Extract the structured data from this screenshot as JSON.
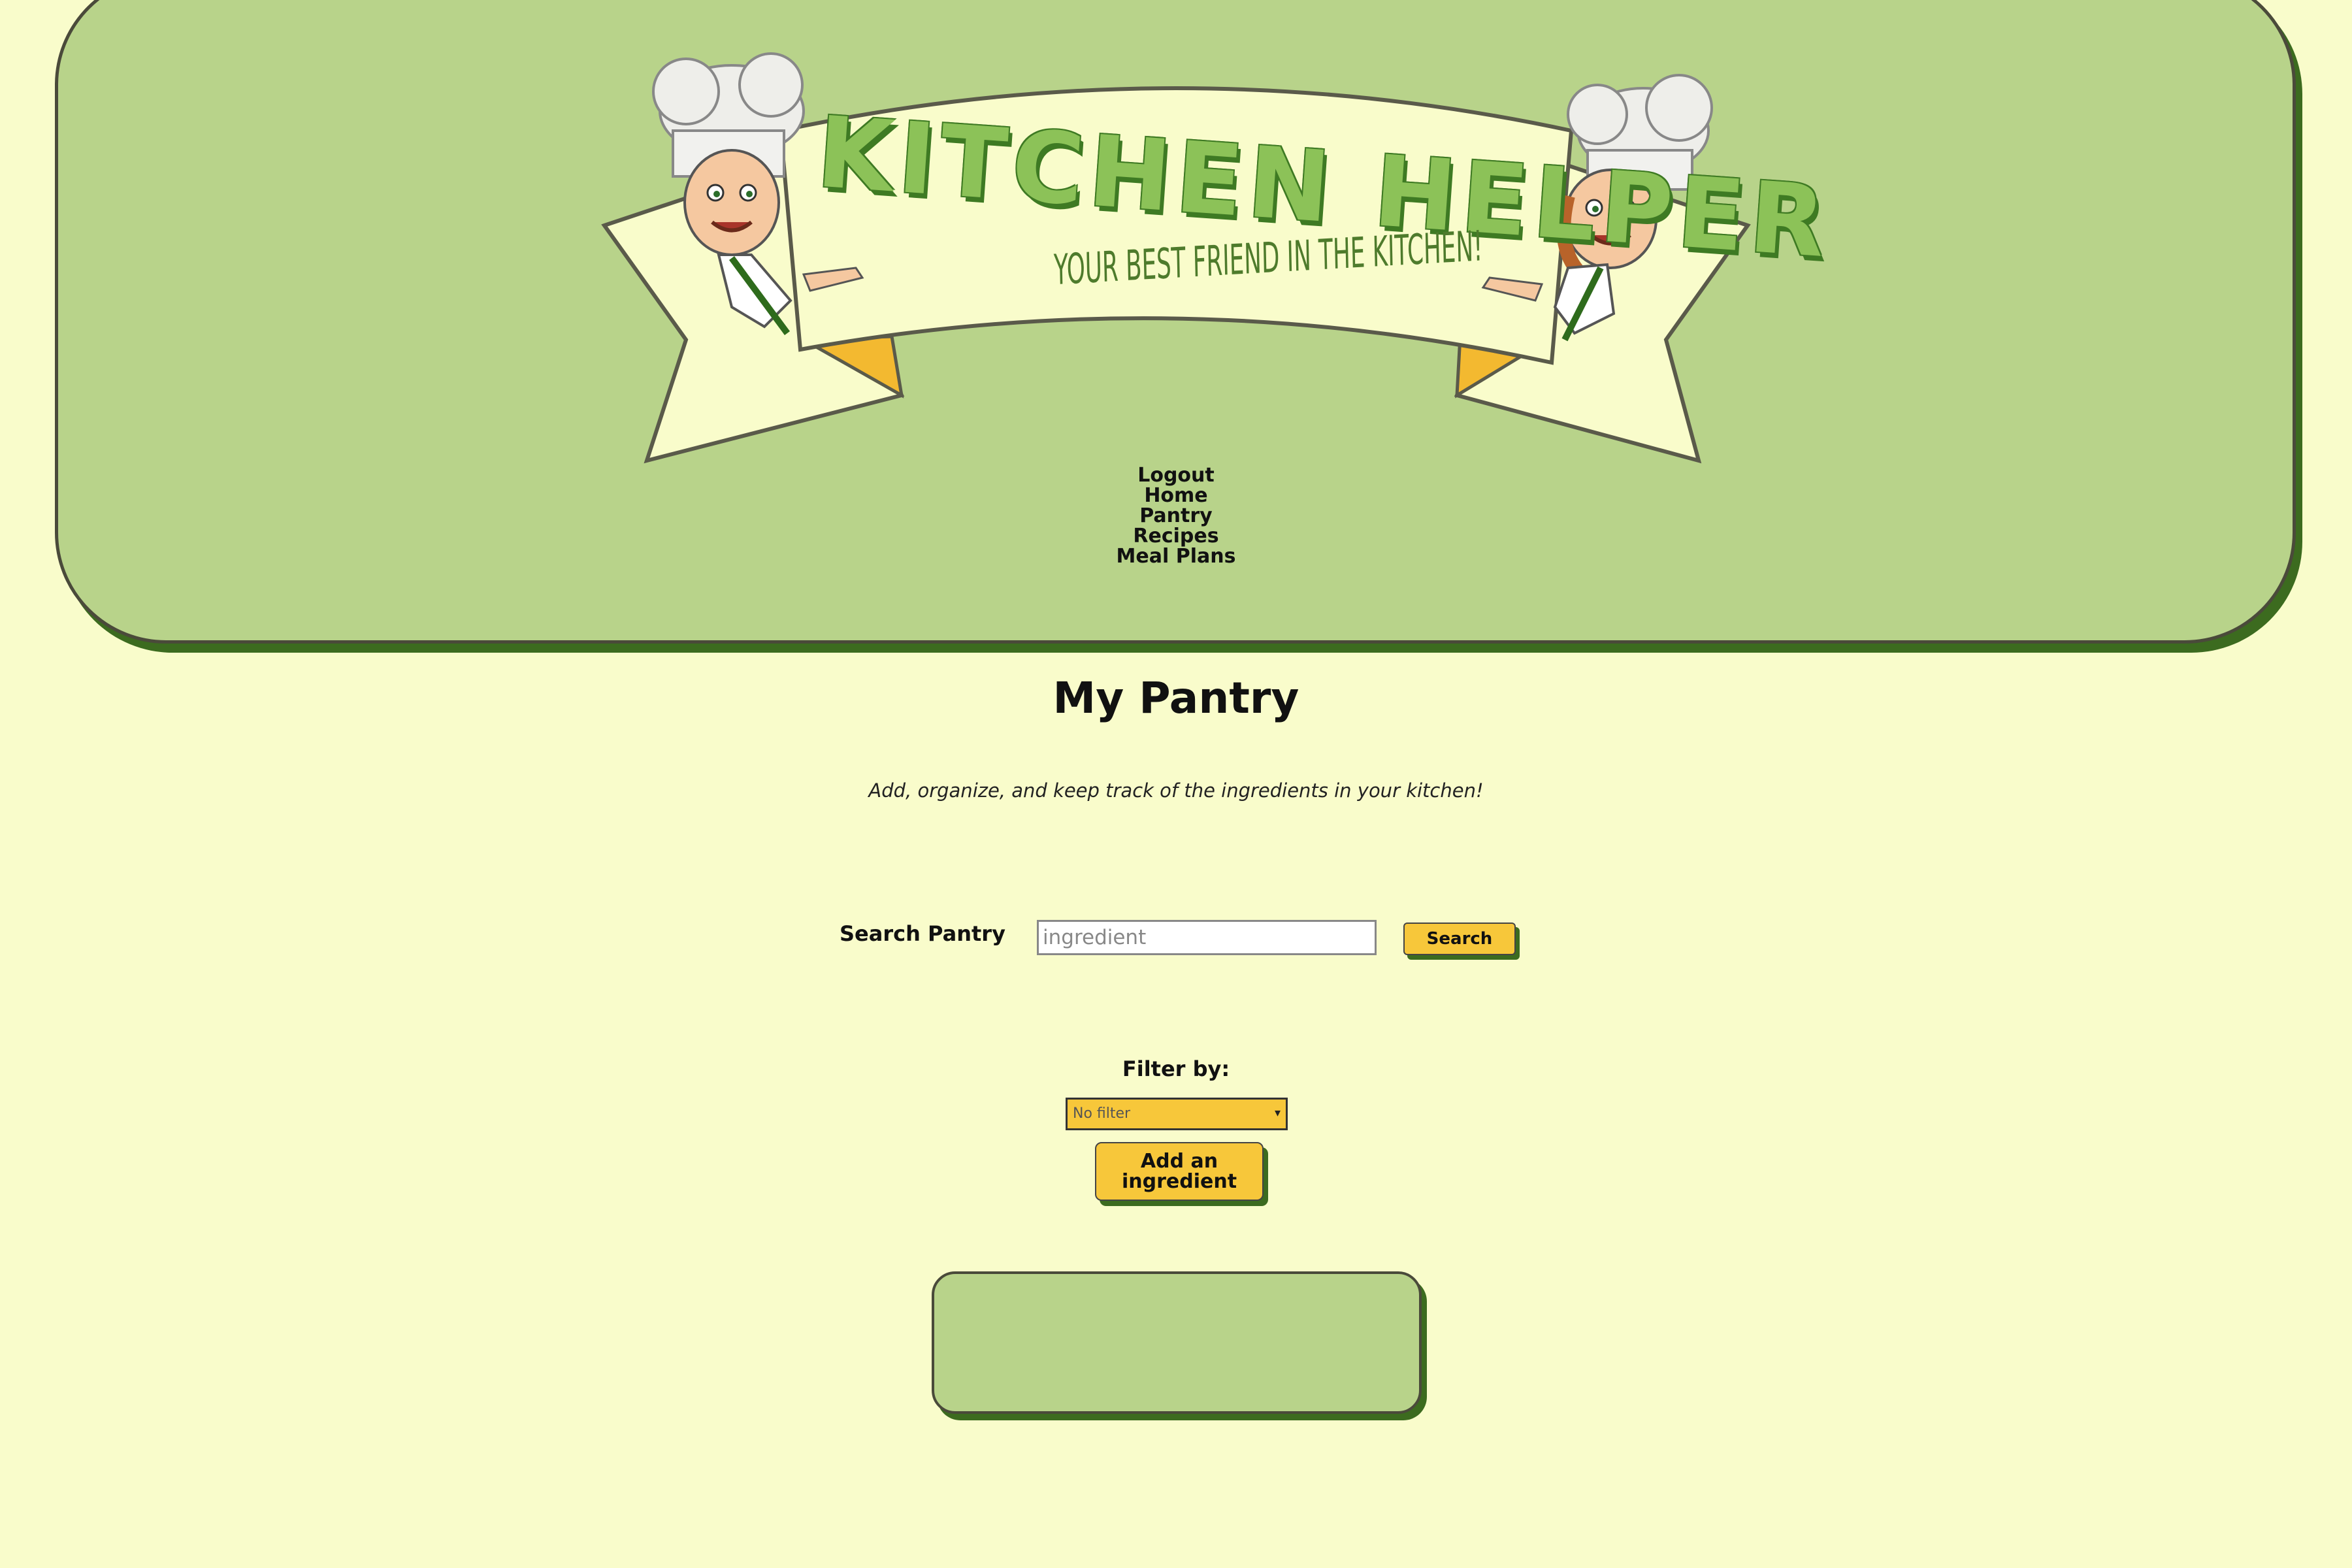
{
  "header": {
    "logo": {
      "title": "KITCHEN HELPER",
      "tagline": "YOUR BEST FRIEND IN THE KITCHEN!"
    },
    "nav": [
      {
        "label": "Logout"
      },
      {
        "label": "Home"
      },
      {
        "label": "Pantry"
      },
      {
        "label": "Recipes"
      },
      {
        "label": "Meal Plans"
      }
    ]
  },
  "main": {
    "title": "My Pantry",
    "subtitle": "Add, organize, and keep track of the ingredients in your kitchen!",
    "search": {
      "label": "Search Pantry",
      "placeholder": "ingredient",
      "value": "",
      "button_label": "Search"
    },
    "filter": {
      "label": "Filter by:",
      "selected": "No filter"
    },
    "add_button_label": "Add an ingredient"
  },
  "colors": {
    "page_background": "#f9fccb",
    "header_green": "#b8d38a",
    "shadow_green": "#3c6b1f",
    "button_yellow": "#f7c73a"
  }
}
